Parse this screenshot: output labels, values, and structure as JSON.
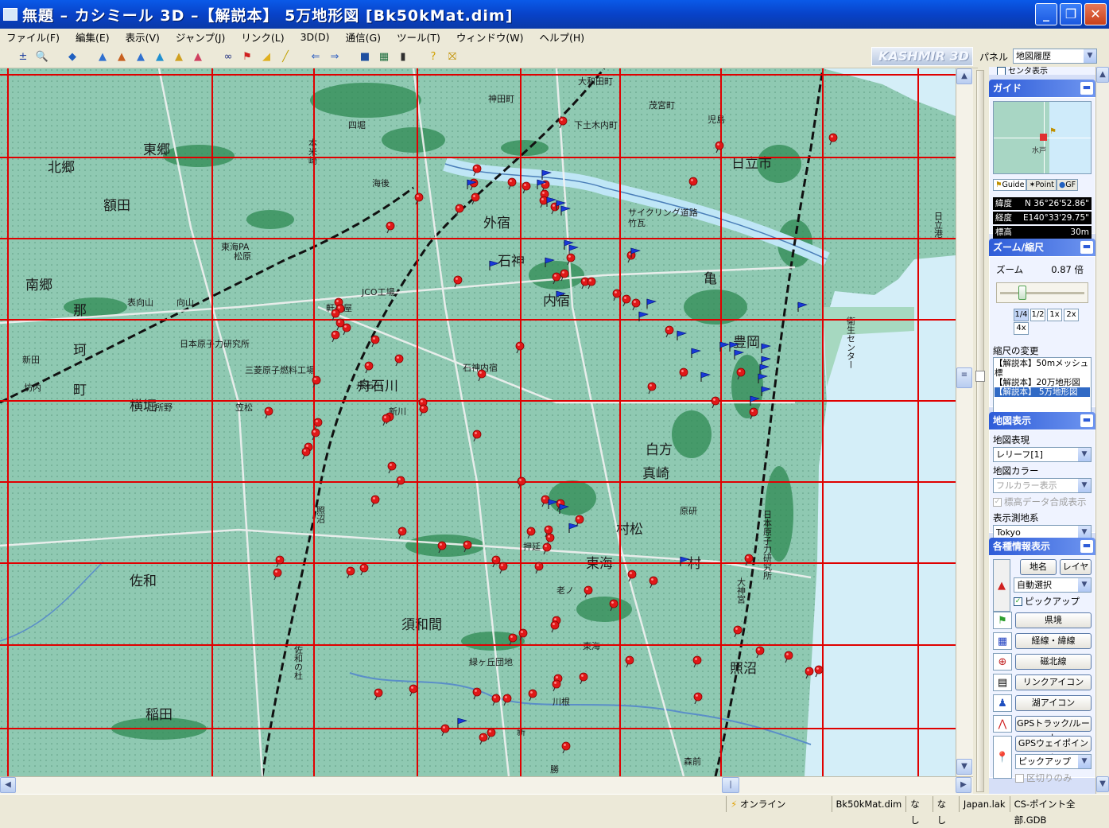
{
  "window": {
    "title": "無題 – カシミール 3D –【解説本】 5万地形図 [Bk50kMat.dim]"
  },
  "menu": [
    "ファイル(F)",
    "編集(E)",
    "表示(V)",
    "ジャンプ(J)",
    "リンク(L)",
    "3D(D)",
    "通信(G)",
    "ツール(T)",
    "ウィンドウ(W)",
    "ヘルプ(H)"
  ],
  "toolbar": {
    "brand": "KASHMIR 3D"
  },
  "panel": {
    "label": "パネル",
    "selected": "地図履歴",
    "partial_top": "センタ表示"
  },
  "guide": {
    "header": "ガイド",
    "minimap_label": "水戸",
    "tabs": [
      "Guide",
      "Point",
      "GF"
    ],
    "lat_label": "緯度",
    "lat_value": "N 36°26'52.86\"",
    "lon_label": "経度",
    "lon_value": "E140°33'29.75\"",
    "alt_label": "標高",
    "alt_value": "30m"
  },
  "zoom": {
    "header": "ズーム/縮尺",
    "label": "ズーム",
    "value": "0.87 倍",
    "slider_position": 0.22,
    "buttons": [
      "1/4",
      "1/2",
      "1x",
      "2x",
      "4x"
    ],
    "scale_label": "縮尺の変更",
    "scale_items": [
      "【解説本】50mメッシュ標",
      "【解説本】20万地形図",
      "【解説本】 5万地形図"
    ],
    "scale_selected": 2
  },
  "mapdisplay": {
    "header": "地図表示",
    "expr_label": "地図表現",
    "expr_value": "レリーフ[1]",
    "color_label": "地図カラー",
    "color_value": "フルカラー表示",
    "elev_check": "標高データ合成表示",
    "datum_label": "表示測地系",
    "datum_value": "Tokyo"
  },
  "info": {
    "header": "各種情報表示",
    "placename_btn": "地名",
    "layer_btn": "レイヤー",
    "auto_select": "自動選択",
    "popup_check": "ピックアップ",
    "buttons": [
      "県境",
      "経線・緯線",
      "磁北線",
      "リンクアイコン",
      "湖アイコン",
      "GPSトラック/ルート",
      "GPSウェイポイント"
    ],
    "pickup_select": "ピックアップ",
    "border_check": "区切りのみ"
  },
  "status": {
    "online": "オンライン",
    "file": "Bk50kMat.dim",
    "c1": "なし",
    "c2": "なし",
    "lak": "Japan.lak",
    "points": "CS-ポイント全部.GDB"
  },
  "map": {
    "place_labels_large": [
      "東郷",
      "北郷",
      "額田",
      "南郷",
      "那",
      "珂",
      "町",
      "横堀",
      "佐和",
      "稲田",
      "舟石川",
      "須和間",
      "外宿",
      "石神",
      "内宿",
      "日立市",
      "村松",
      "東海",
      "村",
      "白方",
      "亀",
      "照沼",
      "豊岡",
      "真崎"
    ],
    "place_labels_small": [
      "四堀",
      "神田町",
      "大和田町",
      "下土木内町",
      "茂宮町",
      "児島",
      "海後",
      "本米崎",
      "松原",
      "表向山",
      "向山",
      "竹瓦",
      "軒茶屋",
      "舟石川",
      "新川",
      "新田",
      "坊内",
      "所野",
      "石神内宿",
      "笠松",
      "照沼",
      "原研",
      "緑ヶ丘団地",
      "川根",
      "森前",
      "勝",
      "佐和の杜",
      "老ノ",
      "押延",
      "新",
      "東海",
      "衛生センター",
      "JCO工場",
      "東海PA",
      "日本原子力研究所",
      "三菱原子燃料工場",
      "日本原子力研究所",
      "大神宮",
      "日立港",
      "サイクリング道路"
    ]
  }
}
